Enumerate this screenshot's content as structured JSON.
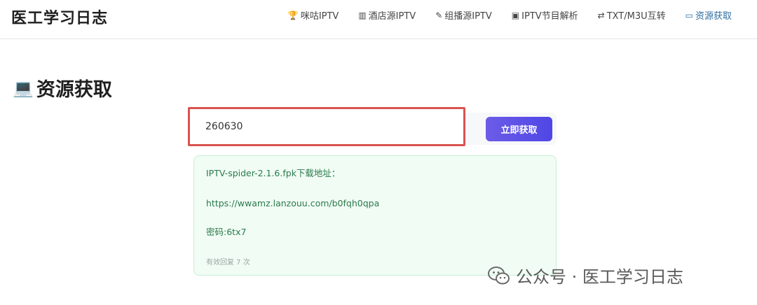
{
  "header": {
    "site_title": "医工学习日志",
    "nav": [
      {
        "icon": "🏆",
        "icon_name": "trophy-icon",
        "label": "咪咕IPTV"
      },
      {
        "icon": "▥",
        "icon_name": "hotel-icon",
        "label": "酒店源IPTV"
      },
      {
        "icon": "✎",
        "icon_name": "multicast-icon",
        "label": "组播源IPTV"
      },
      {
        "icon": "▣",
        "icon_name": "tv-icon",
        "label": "IPTV节目解析"
      },
      {
        "icon": "⇄",
        "icon_name": "convert-icon",
        "label": "TXT/M3U互转"
      },
      {
        "icon": "▭",
        "icon_name": "laptop-icon",
        "label": "资源获取"
      }
    ]
  },
  "page": {
    "heading": "资源获取",
    "heading_icon": "💻"
  },
  "search": {
    "value": "260630",
    "button_label": "立即获取"
  },
  "result": {
    "line1": "IPTV-spider-2.1.6.fpk下载地址：",
    "line2": "https://wwamz.lanzouu.com/b0fqh0qpa",
    "line3": "密码:6tx7",
    "remaining": "有效回复 7 次"
  },
  "watermark": {
    "text": "公众号 · 医工学习日志"
  },
  "colors": {
    "accent": "#4f46e5",
    "highlight_border": "#d9534f",
    "result_bg": "#f0fcf4",
    "result_text": "#2b7a4b"
  }
}
